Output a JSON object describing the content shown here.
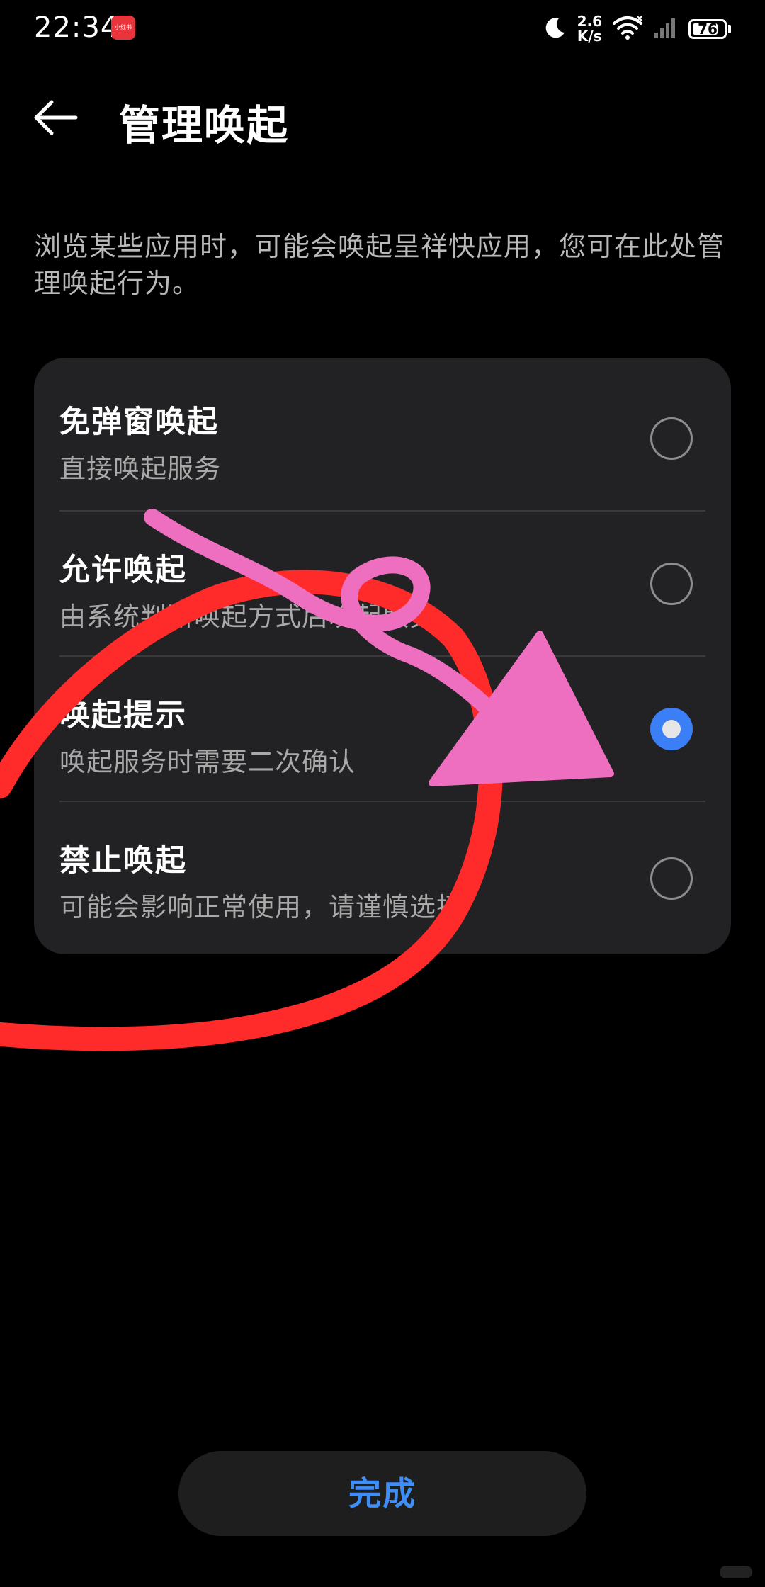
{
  "status_bar": {
    "time": "22:34",
    "badge_label": "小红书",
    "net_speed_value": "2.6",
    "net_speed_unit": "K/s",
    "battery_level": "76",
    "icons": [
      "moon-icon",
      "wifi-icon",
      "signal-icon",
      "battery-icon"
    ]
  },
  "header": {
    "title": "管理唤起",
    "back_icon": "back-arrow-icon"
  },
  "description": "浏览某些应用时，可能会唤起呈祥快应用，您可在此处管理唤起行为。",
  "options": [
    {
      "title": "免弹窗唤起",
      "subtitle": "直接唤起服务",
      "selected": false
    },
    {
      "title": "允许唤起",
      "subtitle": "由系统判断唤起方式后唤起服务",
      "selected": false
    },
    {
      "title": "唤起提示",
      "subtitle": "唤起服务时需要二次确认",
      "selected": true
    },
    {
      "title": "禁止唤起",
      "subtitle": "可能会影响正常使用，请谨慎选择",
      "selected": false
    }
  ],
  "done_button": {
    "label": "完成"
  },
  "colors": {
    "background": "#000000",
    "card": "#222224",
    "accent": "#3a7ff6",
    "done_text": "#3f8ef7",
    "annotation_red": "#ff2a2a",
    "annotation_pink": "#ee6fc0"
  }
}
